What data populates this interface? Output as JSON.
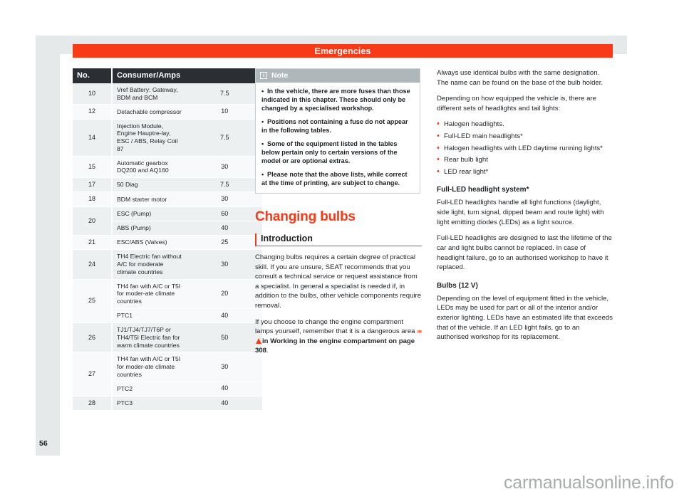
{
  "document": {
    "chapter_title": "Emergencies",
    "page_number": "56",
    "watermark": "carmanualsonline.info",
    "accent_color": "#f93a18",
    "table_header_color": "#2b2f33",
    "note_header_color": "#aeb7b9"
  },
  "fuse_table": {
    "headers": {
      "no": "No.",
      "consumer": "Consumer/Amps"
    },
    "rows": [
      {
        "no": "10",
        "name": "Vref Battery: Gateway, BDM and BCM",
        "amps": "7.5"
      },
      {
        "no": "12",
        "name": "Detachable compressor",
        "amps": "10"
      },
      {
        "no": "14",
        "name": "Injection Module, Engine Hauptre-lay, ESC / ABS, Relay Coil 87",
        "amps": "7.5"
      },
      {
        "no": "15",
        "name": "Automatic gearbox DQ200 and AQ160",
        "amps": "30"
      },
      {
        "no": "17",
        "name": "50 Diag",
        "amps": "7.5"
      },
      {
        "no": "18",
        "name": "BDM starter motor",
        "amps": "30"
      },
      {
        "no": "20",
        "name": "ESC (Pump)",
        "amps": "60"
      },
      {
        "no": "",
        "name": "ABS (Pump)",
        "amps": "40"
      },
      {
        "no": "21",
        "name": "ESC/ABS (Valves)",
        "amps": "25"
      },
      {
        "no": "24",
        "name": "TH4 Electric fan without A/C for moderate climate countries",
        "amps": "30"
      },
      {
        "no": "25",
        "name": "TH4 fan with A/C or T5I for moder-ate climate countries",
        "amps": "20"
      },
      {
        "no": "",
        "name": "PTC1",
        "amps": "40"
      },
      {
        "no": "26",
        "name": "TJ1/TJ4/TJ7/T6P or TH4/T5I Electric fan for warm climate countries",
        "amps": "50"
      },
      {
        "no": "27",
        "name": "TH4 fan with A/C or T5I for moder-ate climate countries",
        "amps": "30"
      },
      {
        "no": "",
        "name": "PTC2",
        "amps": "40"
      },
      {
        "no": "28",
        "name": "PTC3",
        "amps": "40"
      }
    ]
  },
  "note_box": {
    "icon": "info-icon",
    "title": "Note",
    "items": [
      "In the vehicle, there are more fuses than those indicated in this chapter. These should only be changed by a specialised workshop.",
      "Positions not containing a fuse do not appear in the following tables.",
      "Some of the equipment listed in the tables below pertain only to certain versions of the model or are optional extras.",
      "Please note that the above lists, while correct at the time of printing, are subject to change."
    ]
  },
  "changing_bulbs": {
    "section_title": "Changing bulbs",
    "subsection_title": "Introduction",
    "paragraph_1": "Changing bulbs requires a certain degree of practical skill. If you are unsure, SEAT recommends that you consult a technical service or request assistance from a specialist. In general a specialist is needed if, in addition to the bulbs, other vehicle components require removal.",
    "paragraph_2_prefix": "If you choose to change the engine compartment lamps yourself, remember that it is a dangerous area ",
    "paragraph_2_chevron": "›››",
    "paragraph_2_warning_icon": "warning-triangle-icon",
    "paragraph_2_reference": "in Working in the engine compartment on page 308",
    "paragraph_2_suffix": "."
  },
  "right_column": {
    "paragraph_1": "Always use identical bulbs with the same designation. The name can be found on the base of the bulb holder.",
    "paragraph_2": "Depending on how equipped the vehicle is, there are different sets of headlights and tail lights:",
    "bullets": [
      "Halogen headlights.",
      "Full-LED main headlights*",
      "Halogen headlights with LED daytime running lights*",
      "Rear bulb light",
      "LED rear light*"
    ],
    "heading_full_led": "Full-LED headlight system*",
    "paragraph_3": "Full-LED headlights handle all light functions (daylight, side light, turn signal, dipped beam and route light) with light emitting diodes (LEDs) as a light source.",
    "paragraph_4": "Full-LED headlights are designed to last the lifetime of the car and light bulbs cannot be replaced. In case of headlight failure, go to an authorised workshop to have it replaced.",
    "heading_bulbs": "Bulbs (12 V)",
    "paragraph_5": "Depending on the level of equipment fitted in the vehicle, LEDs may be used for part or all of the interior and/or exterior lighting. LEDs have an estimated life that exceeds that of the vehicle. If an LED light fails, go to an authorised workshop for its replacement."
  }
}
